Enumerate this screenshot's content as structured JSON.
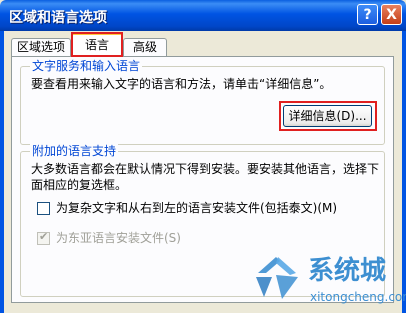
{
  "window": {
    "title": "区域和语言选项",
    "help": "?",
    "close": "X"
  },
  "tabs": [
    {
      "label": "区域选项",
      "active": false
    },
    {
      "label": "语言",
      "active": true
    },
    {
      "label": "高级",
      "active": false
    }
  ],
  "text_services": {
    "title": "文字服务和输入语言",
    "description": "要查看用来输入文字的语言和方法，请单击“详细信息”。",
    "details_button": "详细信息(D)..."
  },
  "supplemental": {
    "title": "附加的语言支持",
    "description": "大多数语言都会在默认情况下得到安装。要安装其他语言，选择下面相应的复选框。",
    "complex_script_label": "为复杂文字和从右到左的语言安装文件(包括泰文)(M)",
    "complex_script_checked": false,
    "east_asian_label": "为东亚语言安装文件(S)",
    "east_asian_checked": true,
    "east_asian_enabled": false
  },
  "watermark": {
    "brand": "系统城",
    "url": "xitongcheng.com"
  },
  "colors": {
    "highlight": "#e02020",
    "group_title": "#0046d5",
    "title_bar": "#0054e3"
  }
}
